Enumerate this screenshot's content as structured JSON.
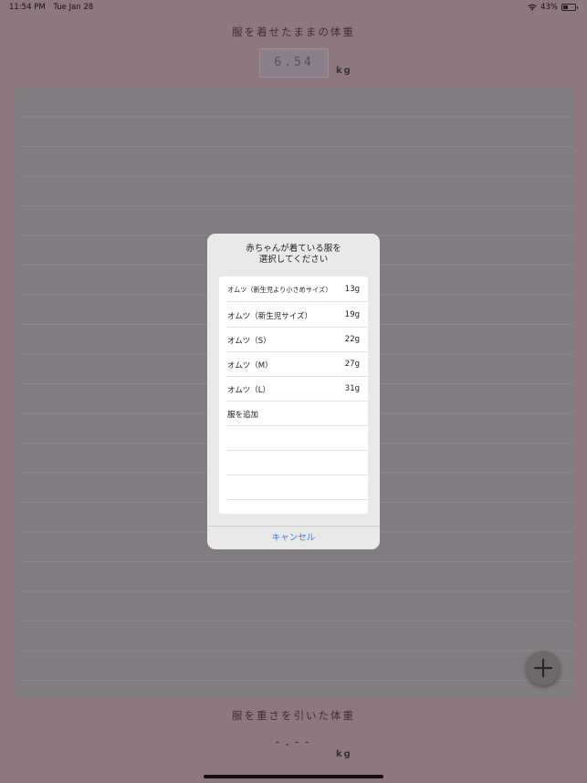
{
  "status_bar": {
    "time": "11:54 PM",
    "date": "Tue Jan 28",
    "battery_percent": "43%",
    "battery_level": 0.43
  },
  "header": {
    "title": "服を着せたままの体重",
    "weight_value": "6.54",
    "unit": "kg"
  },
  "footer": {
    "title": "服を重さを引いた体重",
    "weight_value": "-.--",
    "unit": "kg"
  },
  "dialog": {
    "title_line1": "赤ちゃんが着ている服を",
    "title_line2": "選択してください",
    "options": [
      {
        "name": "オムツ（新生児より小さめサイズ）",
        "weight": "13g"
      },
      {
        "name": "オムツ（新生児サイズ）",
        "weight": "19g"
      },
      {
        "name": "オムツ（S）",
        "weight": "22g"
      },
      {
        "name": "オムツ（M）",
        "weight": "27g"
      },
      {
        "name": "オムツ（L）",
        "weight": "31g"
      },
      {
        "name": "服を追加",
        "weight": ""
      }
    ],
    "cancel_label": "キャンセル"
  },
  "icons": {
    "add": "plus-icon",
    "wifi": "wifi-icon",
    "battery": "battery-icon"
  },
  "colors": {
    "accent": "#2f7bea",
    "overlay_background": "#8e7880"
  }
}
